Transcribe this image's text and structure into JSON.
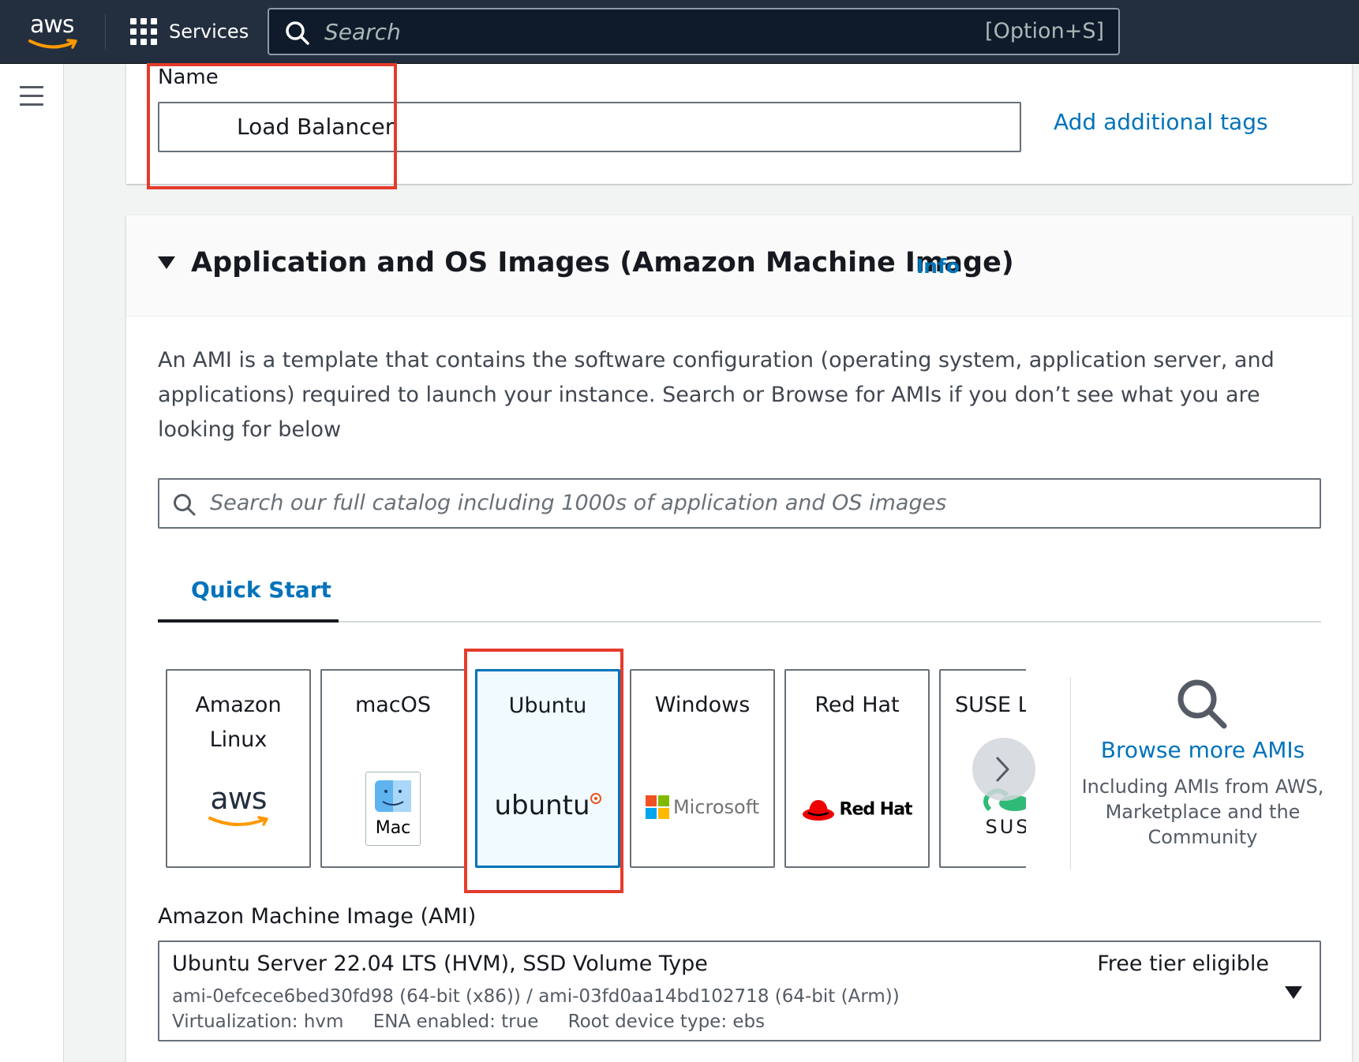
{
  "topbar": {
    "logo_text": "aws",
    "services_label": "Services",
    "search_placeholder": "Search",
    "search_shortcut": "[Option+S]"
  },
  "name_section": {
    "label": "Name",
    "value": "Load Balancer",
    "add_tags_link": "Add additional tags"
  },
  "ami_section": {
    "title": "Application and OS Images (Amazon Machine Image)",
    "info_link": "Info",
    "description": "An AMI is a template that contains the software configuration (operating system, application server, and applications) required to launch your instance. Search or Browse for AMIs if you don’t see what you are looking for below",
    "search_placeholder": "Search our full catalog including 1000s of application and OS images",
    "tab_quick_start": "Quick Start",
    "os_options": [
      {
        "name": "Amazon Linux",
        "logo_text": "aws",
        "selected": false
      },
      {
        "name": "macOS",
        "logo_text": "Mac",
        "selected": false
      },
      {
        "name": "Ubuntu",
        "logo_text": "ubuntu",
        "selected": true
      },
      {
        "name": "Windows",
        "logo_text": "Microsoft",
        "selected": false
      },
      {
        "name": "Red Hat",
        "logo_text": "Red Hat",
        "selected": false
      },
      {
        "name": "SUSE Li",
        "logo_text": "SUS",
        "selected": false
      }
    ],
    "browse": {
      "link": "Browse more AMIs",
      "subtitle": "Including AMIs from AWS, Marketplace and the Community"
    },
    "ami_label": "Amazon Machine Image (AMI)",
    "ami_selected": {
      "title": "Ubuntu Server 22.04 LTS (HVM), SSD Volume Type",
      "ids": "ami-0efcece6bed30fd98 (64-bit (x86)) / ami-03fd0aa14bd102718 (64-bit (Arm))",
      "virtualization": "Virtualization: hvm",
      "ena": "ENA enabled: true",
      "root_device": "Root device type: ebs",
      "badge": "Free tier eligible"
    }
  },
  "colors": {
    "topbar_bg": "#232f3e",
    "link": "#0073bb",
    "highlight": "#e53b2c",
    "aws_orange": "#ff9900"
  }
}
